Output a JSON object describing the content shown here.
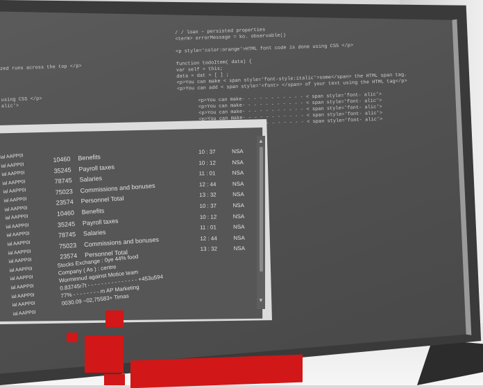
{
  "code_lines_right": [
    "/ / loan – persisted properties",
    "  <term> errorMessage = ko. observable()",
    "",
    "<p style='color:orange'>HTML font code is done using CSS </p>",
    "",
    "function  todoItem( data) {",
    "   var  self = this;",
    "   data = dat = [ ] ;",
    "<p>You can make < span style='font-style:italic'>some</span> the HTML span tag.",
    "<p>You can add < span style='<font> </span> of your text using the HTML tag</p>",
    "",
    "<p>You can make- - - - - - - - - - - < span style='font- alic'>",
    "<p>You can make- - - - - - - - - - - < span style='font- alic'>",
    "<p>You can make- - - - - - - - - - - < span style='font- alic'>",
    "<p>You can make- - - - - - - - - - - < span style='font- alic'>",
    "<p>You can make- - - - - - - - - - - < span style='font- alic'>"
  ],
  "code_lines_left": [
    "zed runs across the top </p>",
    "",
    "",
    "",
    "",
    "using CSS </p>",
    "alic'>"
  ],
  "window": {
    "codes": [
      "ial  AAPP0I",
      "ial  AAPP0I",
      "ial  AAPP0I",
      "ial  AAPP0I",
      "ial  AAPP0I",
      "ial  AAPP0I",
      "ial  AAPP0I",
      "ial  AAPP0I",
      "ial  AAPP0I",
      "ial  AAPP0I",
      "ial  AAPP0I",
      "ial  AAPP0I",
      "ial  AAPP0I",
      "ial  AAPP0I",
      "ial  AAPP0I",
      "ial  AAPP0I",
      "ial  AAPP0I",
      "ial  AAPP0I",
      "ial  AAPP0I"
    ],
    "rows": [
      {
        "num": "10460",
        "label": "Benefits"
      },
      {
        "num": "35245",
        "label": "Payroll taxes"
      },
      {
        "num": "78745",
        "label": "Salaries"
      },
      {
        "num": "75023",
        "label": "Commissions and bonuses"
      },
      {
        "num": "23574",
        "label": "Personnel Total"
      },
      {
        "num": "10460",
        "label": "Benefits"
      },
      {
        "num": "35245",
        "label": "Payroll taxes"
      },
      {
        "num": "78745",
        "label": "Salaries"
      },
      {
        "num": "75023",
        "label": "Commissions and bonuses"
      },
      {
        "num": "23574",
        "label": "Personnel Total"
      }
    ],
    "times": [
      {
        "time": "10 : 37",
        "code": "NSA"
      },
      {
        "time": "10 : 12",
        "code": "NSA"
      },
      {
        "time": "11 : 01",
        "code": "NSA"
      },
      {
        "time": "12 : 44",
        "code": "NSA"
      },
      {
        "time": "13 : 32",
        "code": "NSA"
      },
      {
        "time": "10 : 37",
        "code": "NSA"
      },
      {
        "time": "10 : 12",
        "code": "NSA"
      },
      {
        "time": "11 : 01",
        "code": "NSA"
      },
      {
        "time": "12 : 44",
        "code": "NSA"
      },
      {
        "time": "13 : 32",
        "code": "NSA"
      }
    ],
    "notes": [
      "Stocks Exchange : 0ye 44% food",
      "Company ( As ) : centre",
      "Worminnud   against Motice team",
      "0.83745r7t  - - - - - - - - - - - - - - - +453u594",
      "77% - - - - - - - - m AP Marketing",
      "0030.09 ~02,75583+ Timas"
    ]
  }
}
